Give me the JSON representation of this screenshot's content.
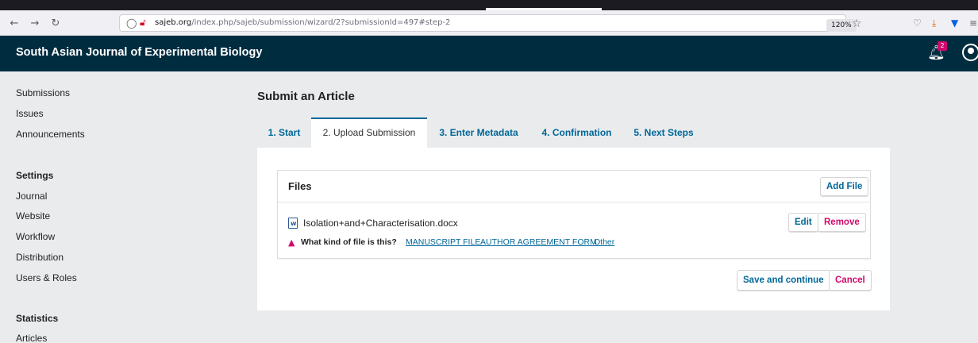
{
  "browser": {
    "url_domain": "sajeb.org",
    "url_path": "/index.php/sajeb/submission/wizard/2?submissionId=497#step-2",
    "zoom": "120%"
  },
  "header": {
    "journal_title": "South Asian Journal of Experimental Biology",
    "notification_count": "2"
  },
  "sidebar": {
    "items": [
      {
        "label": "Submissions"
      },
      {
        "label": "Issues"
      },
      {
        "label": "Announcements"
      },
      {
        "label": "Settings"
      },
      {
        "label": "Journal"
      },
      {
        "label": "Website"
      },
      {
        "label": "Workflow"
      },
      {
        "label": "Distribution"
      },
      {
        "label": "Users & Roles"
      },
      {
        "label": "Statistics"
      },
      {
        "label": "Articles"
      }
    ]
  },
  "main": {
    "title": "Submit an Article",
    "tabs": [
      {
        "label": "1. Start"
      },
      {
        "label": "2. Upload Submission"
      },
      {
        "label": "3. Enter Metadata"
      },
      {
        "label": "4. Confirmation"
      },
      {
        "label": "5. Next Steps"
      }
    ],
    "active_tab": 1,
    "files": {
      "title": "Files",
      "add_label": "Add File",
      "filename": "Isolation+and+Characterisation.docx",
      "edit_label": "Edit",
      "remove_label": "Remove",
      "question": "What kind of file is this?",
      "genres": [
        "MANUSCRIPT FILE",
        "AUTHOR AGREEMENT FORM",
        "Other"
      ]
    },
    "save_label": "Save and continue",
    "cancel_label": "Cancel"
  },
  "colors": {
    "header_bg": "#002c40",
    "link": "#006798",
    "danger": "#d00a6c"
  }
}
